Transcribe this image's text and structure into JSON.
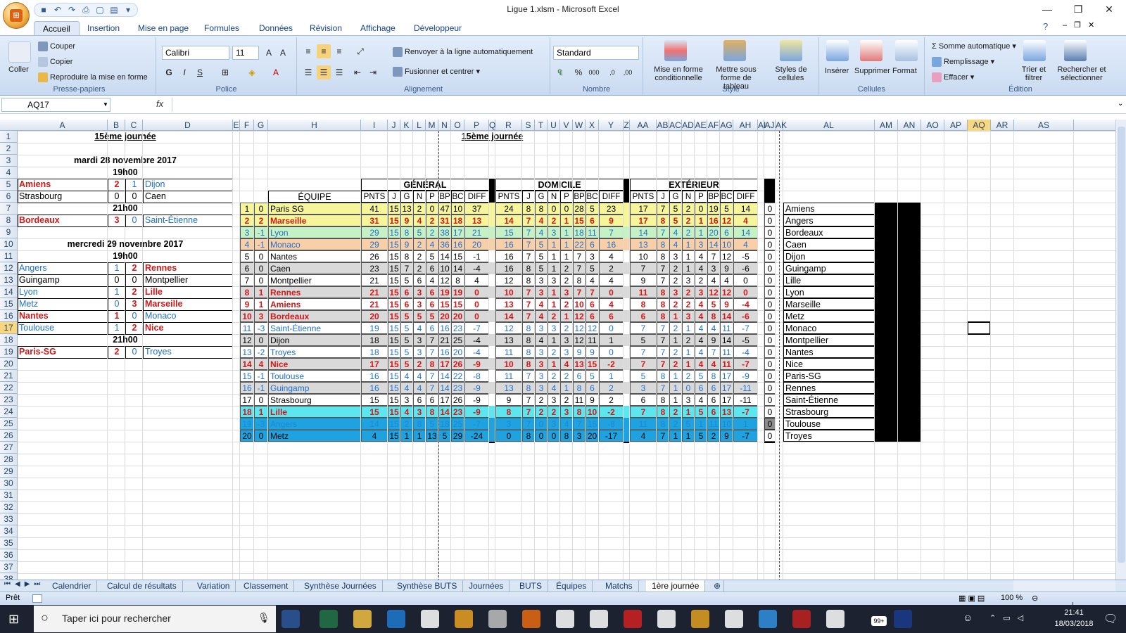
{
  "window": {
    "title": "Ligue 1.xlsm - Microsoft Excel"
  },
  "tabs": [
    "Accueil",
    "Insertion",
    "Mise en page",
    "Formules",
    "Données",
    "Révision",
    "Affichage",
    "Développeur"
  ],
  "ribbon": {
    "couper": "Couper",
    "copier": "Copier",
    "reproduire": "Reproduire la mise en forme",
    "coller": "Coller",
    "presse": "Presse-papiers",
    "font": "Calibri",
    "size": "11",
    "police": "Police",
    "renvoyer": "Renvoyer à la ligne automatiquement",
    "fusionner": "Fusionner et centrer",
    "alignement": "Alignement",
    "format": "Standard",
    "nombre": "Nombre",
    "misecond": "Mise en forme conditionnelle",
    "mettre": "Mettre sous forme de tableau",
    "styles": "Styles de cellules",
    "style": "Style",
    "inserer": "Insérer",
    "supprimer": "Supprimer",
    "formatb": "Format",
    "cellules": "Cellules",
    "somme": "Somme automatique",
    "remplissage": "Remplissage",
    "effacer": "Effacer",
    "trier": "Trier et filtrer",
    "rechercher": "Rechercher et sélectionner",
    "edition": "Édition"
  },
  "formula": {
    "namebox": "AQ17",
    "fx": "fx"
  },
  "cols": [
    [
      "A",
      25,
      128
    ],
    [
      "B",
      153,
      25
    ],
    [
      "C",
      178,
      25
    ],
    [
      "D",
      203,
      128
    ],
    [
      "E",
      331,
      10
    ],
    [
      "F",
      341,
      20
    ],
    [
      "G",
      361,
      20
    ],
    [
      "H",
      381,
      132
    ],
    [
      "I",
      513,
      38
    ],
    [
      "J",
      551,
      18
    ],
    [
      "K",
      569,
      18
    ],
    [
      "L",
      587,
      18
    ],
    [
      "M",
      605,
      18
    ],
    [
      "N",
      623,
      18
    ],
    [
      "O",
      641,
      19
    ],
    [
      "P",
      660,
      35
    ],
    [
      "Q",
      695,
      9
    ],
    [
      "R",
      704,
      38
    ],
    [
      "S",
      742,
      18
    ],
    [
      "T",
      760,
      18
    ],
    [
      "U",
      778,
      18
    ],
    [
      "V",
      796,
      18
    ],
    [
      "W",
      814,
      18
    ],
    [
      "X",
      832,
      19
    ],
    [
      "Y",
      851,
      35
    ],
    [
      "Z",
      886,
      9
    ],
    [
      "AA",
      895,
      38
    ],
    [
      "AB",
      933,
      18
    ],
    [
      "AC",
      951,
      18
    ],
    [
      "AD",
      969,
      18
    ],
    [
      "AE",
      987,
      18
    ],
    [
      "AF",
      1005,
      18
    ],
    [
      "AG",
      1023,
      19
    ],
    [
      "AH",
      1042,
      35
    ],
    [
      "AI",
      1077,
      9
    ],
    [
      "AJ",
      1086,
      16
    ],
    [
      "AK",
      1102,
      11
    ],
    [
      "AL",
      1113,
      130
    ],
    [
      "AM",
      1243,
      33
    ],
    [
      "AN",
      1276,
      33
    ],
    [
      "AO",
      1309,
      33
    ],
    [
      "AP",
      1342,
      33
    ],
    [
      "AQ",
      1375,
      33
    ],
    [
      "AR",
      1408,
      33
    ],
    [
      "AS",
      1441,
      85
    ]
  ],
  "left": {
    "title": "15ème journée",
    "date1": "mardi 28 novembre 2017",
    "time1": "19h00",
    "time2": "21h00",
    "date2": "mercredi 29 novembre 2017",
    "time3": "19h00",
    "time4": "21h00",
    "matches": [
      {
        "row": 5,
        "home": "Amiens",
        "hs": "2",
        "as": "1",
        "away": "Dijon",
        "win": "home"
      },
      {
        "row": 6,
        "home": "Strasbourg",
        "hs": "0",
        "as": "0",
        "away": "Caen",
        "win": "none"
      },
      {
        "row": 8,
        "home": "Bordeaux",
        "hs": "3",
        "as": "0",
        "away": "Saint-Étienne",
        "win": "home"
      },
      {
        "row": 12,
        "home": "Angers",
        "hs": "1",
        "as": "2",
        "away": "Rennes",
        "win": "away"
      },
      {
        "row": 13,
        "home": "Guingamp",
        "hs": "0",
        "as": "0",
        "away": "Montpellier",
        "win": "none"
      },
      {
        "row": 14,
        "home": "Lyon",
        "hs": "1",
        "as": "2",
        "away": "Lille",
        "win": "away"
      },
      {
        "row": 15,
        "home": "Metz",
        "hs": "0",
        "as": "3",
        "away": "Marseille",
        "win": "away"
      },
      {
        "row": 16,
        "home": "Nantes",
        "hs": "1",
        "as": "0",
        "away": "Monaco",
        "win": "home"
      },
      {
        "row": 17,
        "home": "Toulouse",
        "hs": "1",
        "as": "2",
        "away": "Nice",
        "win": "away"
      },
      {
        "row": 19,
        "home": "Paris-SG",
        "hs": "2",
        "as": "0",
        "away": "Troyes",
        "win": "home"
      }
    ]
  },
  "standings": {
    "title": "15ème journée",
    "general": "GÉNÉRAL",
    "domicile": "DOMICILE",
    "exterieur": "EXTÉRIEUR",
    "equipe": "ÉQUIPE",
    "sub": [
      "PNTS",
      "J",
      "G",
      "N",
      "P",
      "BP",
      "BC",
      "DIFF"
    ],
    "rows": [
      [
        "1",
        "0",
        "Paris SG",
        "41",
        "15",
        "13",
        "2",
        "0",
        "47",
        "10",
        "37",
        "24",
        "8",
        "8",
        "0",
        "0",
        "28",
        "5",
        "23",
        "17",
        "7",
        "5",
        "2",
        "0",
        "19",
        "5",
        "14",
        "0",
        "#f7f59a",
        "n"
      ],
      [
        "2",
        "2",
        "Marseille",
        "31",
        "15",
        "9",
        "4",
        "2",
        "31",
        "18",
        "13",
        "14",
        "7",
        "4",
        "2",
        "1",
        "15",
        "6",
        "9",
        "17",
        "8",
        "5",
        "2",
        "1",
        "16",
        "12",
        "4",
        "0",
        "#f7f59a",
        "r"
      ],
      [
        "3",
        "-1",
        "Lyon",
        "29",
        "15",
        "8",
        "5",
        "2",
        "38",
        "17",
        "21",
        "15",
        "7",
        "4",
        "3",
        "1",
        "18",
        "11",
        "7",
        "14",
        "7",
        "4",
        "2",
        "1",
        "20",
        "6",
        "14",
        "0",
        "#c5f2c5",
        "b"
      ],
      [
        "4",
        "-1",
        "Monaco",
        "29",
        "15",
        "9",
        "2",
        "4",
        "36",
        "16",
        "20",
        "16",
        "7",
        "5",
        "1",
        "1",
        "22",
        "6",
        "16",
        "13",
        "8",
        "4",
        "1",
        "3",
        "14",
        "10",
        "4",
        "0",
        "#f9cfa8",
        "b"
      ],
      [
        "5",
        "0",
        "Nantes",
        "26",
        "15",
        "8",
        "2",
        "5",
        "14",
        "15",
        "-1",
        "16",
        "7",
        "5",
        "1",
        "1",
        "7",
        "3",
        "4",
        "10",
        "8",
        "3",
        "1",
        "4",
        "7",
        "12",
        "-5",
        "0",
        "#ffffff",
        "n"
      ],
      [
        "6",
        "0",
        "Caen",
        "23",
        "15",
        "7",
        "2",
        "6",
        "10",
        "14",
        "-4",
        "16",
        "8",
        "5",
        "1",
        "2",
        "7",
        "5",
        "2",
        "7",
        "7",
        "2",
        "1",
        "4",
        "3",
        "9",
        "-6",
        "0",
        "#d9d9d9",
        "n"
      ],
      [
        "7",
        "0",
        "Montpellier",
        "21",
        "15",
        "5",
        "6",
        "4",
        "12",
        "8",
        "4",
        "12",
        "8",
        "3",
        "3",
        "2",
        "8",
        "4",
        "4",
        "9",
        "7",
        "2",
        "3",
        "2",
        "4",
        "4",
        "0",
        "0",
        "#ffffff",
        "n"
      ],
      [
        "8",
        "1",
        "Rennes",
        "21",
        "15",
        "6",
        "3",
        "6",
        "19",
        "19",
        "0",
        "10",
        "7",
        "3",
        "1",
        "3",
        "7",
        "7",
        "0",
        "11",
        "8",
        "3",
        "2",
        "3",
        "12",
        "12",
        "0",
        "0",
        "#d9d9d9",
        "r"
      ],
      [
        "9",
        "1",
        "Amiens",
        "21",
        "15",
        "6",
        "3",
        "6",
        "15",
        "15",
        "0",
        "13",
        "7",
        "4",
        "1",
        "2",
        "10",
        "6",
        "4",
        "8",
        "8",
        "2",
        "2",
        "4",
        "5",
        "9",
        "-4",
        "0",
        "#ffffff",
        "r"
      ],
      [
        "10",
        "3",
        "Bordeaux",
        "20",
        "15",
        "5",
        "5",
        "5",
        "20",
        "20",
        "0",
        "14",
        "7",
        "4",
        "2",
        "1",
        "12",
        "6",
        "6",
        "6",
        "8",
        "1",
        "3",
        "4",
        "8",
        "14",
        "-6",
        "0",
        "#d9d9d9",
        "r"
      ],
      [
        "11",
        "-3",
        "Saint-Étienne",
        "19",
        "15",
        "5",
        "4",
        "6",
        "16",
        "23",
        "-7",
        "12",
        "8",
        "3",
        "3",
        "2",
        "12",
        "12",
        "0",
        "7",
        "7",
        "2",
        "1",
        "4",
        "4",
        "11",
        "-7",
        "0",
        "#ffffff",
        "b"
      ],
      [
        "12",
        "0",
        "Dijon",
        "18",
        "15",
        "5",
        "3",
        "7",
        "21",
        "25",
        "-4",
        "13",
        "8",
        "4",
        "1",
        "3",
        "12",
        "11",
        "1",
        "5",
        "7",
        "1",
        "2",
        "4",
        "9",
        "14",
        "-5",
        "0",
        "#d9d9d9",
        "n"
      ],
      [
        "13",
        "-2",
        "Troyes",
        "18",
        "15",
        "5",
        "3",
        "7",
        "16",
        "20",
        "-4",
        "11",
        "8",
        "3",
        "2",
        "3",
        "9",
        "9",
        "0",
        "7",
        "7",
        "2",
        "1",
        "4",
        "7",
        "11",
        "-4",
        "0",
        "#ffffff",
        "b"
      ],
      [
        "14",
        "4",
        "Nice",
        "17",
        "15",
        "5",
        "2",
        "8",
        "17",
        "26",
        "-9",
        "10",
        "8",
        "3",
        "1",
        "4",
        "13",
        "15",
        "-2",
        "7",
        "7",
        "2",
        "1",
        "4",
        "4",
        "11",
        "-7",
        "0",
        "#d9d9d9",
        "r"
      ],
      [
        "15",
        "-1",
        "Toulouse",
        "16",
        "15",
        "4",
        "4",
        "7",
        "14",
        "22",
        "-8",
        "11",
        "7",
        "3",
        "2",
        "2",
        "6",
        "5",
        "1",
        "5",
        "8",
        "1",
        "2",
        "5",
        "8",
        "17",
        "-9",
        "0",
        "#ffffff",
        "b"
      ],
      [
        "16",
        "-1",
        "Guingamp",
        "16",
        "15",
        "4",
        "4",
        "7",
        "14",
        "23",
        "-9",
        "13",
        "8",
        "3",
        "4",
        "1",
        "8",
        "6",
        "2",
        "3",
        "7",
        "1",
        "0",
        "6",
        "6",
        "17",
        "-11",
        "0",
        "#d9d9d9",
        "b"
      ],
      [
        "17",
        "0",
        "Strasbourg",
        "15",
        "15",
        "3",
        "6",
        "6",
        "17",
        "26",
        "-9",
        "9",
        "7",
        "2",
        "3",
        "2",
        "11",
        "9",
        "2",
        "6",
        "8",
        "1",
        "3",
        "4",
        "6",
        "17",
        "-11",
        "0",
        "#ffffff",
        "n"
      ],
      [
        "18",
        "1",
        "Lille",
        "15",
        "15",
        "4",
        "3",
        "8",
        "14",
        "23",
        "-9",
        "8",
        "7",
        "2",
        "2",
        "3",
        "8",
        "10",
        "-2",
        "7",
        "8",
        "2",
        "1",
        "5",
        "6",
        "13",
        "-7",
        "0",
        "#5ee6ef",
        "r"
      ],
      [
        "19",
        "-3",
        "Angers",
        "14",
        "15",
        "2",
        "8",
        "5",
        "18",
        "25",
        "-7",
        "3",
        "7",
        "0",
        "3",
        "4",
        "7",
        "15",
        "-8",
        "11",
        "8",
        "2",
        "5",
        "1",
        "11",
        "10",
        "1",
        "0",
        "#1fa3e0",
        "b"
      ],
      [
        "20",
        "0",
        "Metz",
        "4",
        "15",
        "1",
        "1",
        "13",
        "5",
        "29",
        "-24",
        "0",
        "8",
        "0",
        "0",
        "8",
        "3",
        "20",
        "-17",
        "4",
        "7",
        "1",
        "1",
        "5",
        "2",
        "9",
        "-7",
        "0",
        "#1fa3e0",
        "n"
      ]
    ]
  },
  "teamlist": [
    "Amiens",
    "Angers",
    "Bordeaux",
    "Caen",
    "Dijon",
    "Guingamp",
    "Lille",
    "Lyon",
    "Marseille",
    "Metz",
    "Monaco",
    "Montpellier",
    "Nantes",
    "Nice",
    "Paris-SG",
    "Rennes",
    "Saint-Étienne",
    "Strasbourg",
    "Toulouse",
    "Troyes"
  ],
  "sheets": [
    "Calendrier",
    "Calcul de résultats",
    "Variation",
    "Classement",
    "Synthèse Journées",
    "Synthèse BUTS",
    "Journées",
    "BUTS",
    "Équipes",
    "Matchs",
    "1ère journée"
  ],
  "status": {
    "ready": "Prêt",
    "zoom": "100 %"
  },
  "taskbar": {
    "search": "Taper ici pour rechercher",
    "time": "21:41",
    "date": "18/03/2018",
    "badge": "99+"
  },
  "colors": {
    "red": "#d11818",
    "blue": "#1f6fd0",
    "accent": "#f9d77f"
  }
}
